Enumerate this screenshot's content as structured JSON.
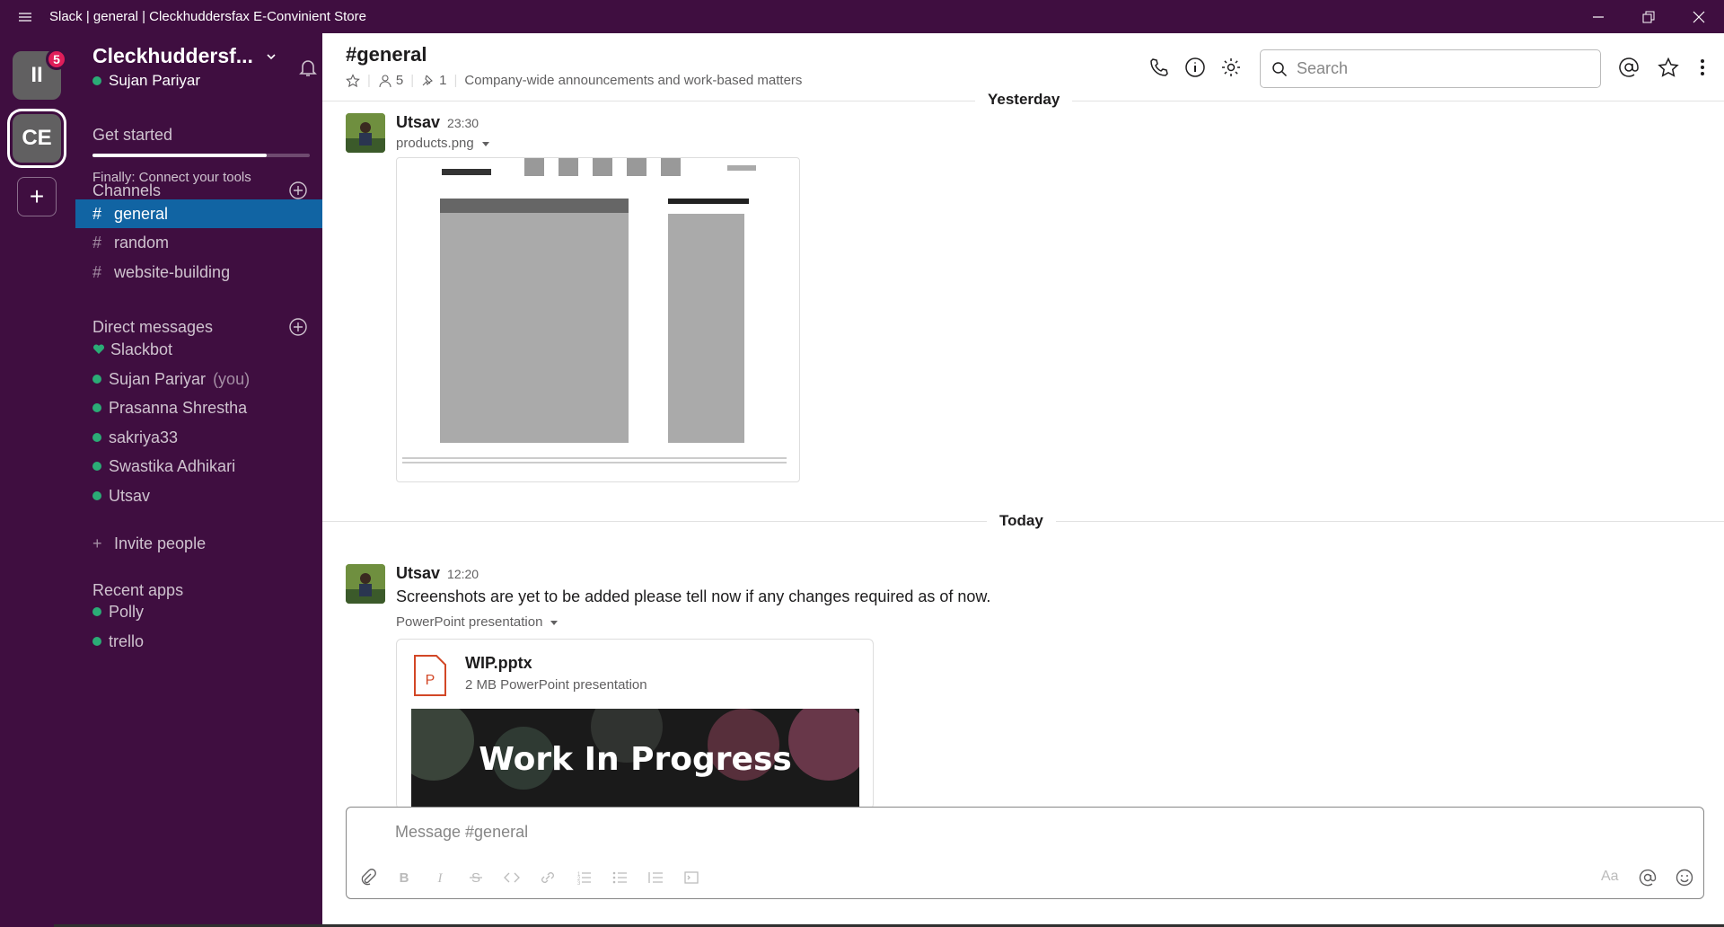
{
  "window": {
    "title": "Slack | general | Cleckhuddersfax E-Convinient Store"
  },
  "workspaces": [
    {
      "label": "II",
      "badge": "5"
    },
    {
      "label": "CE"
    },
    {
      "label": "+"
    }
  ],
  "sidebar": {
    "team_name": "Cleckhuddersf...",
    "user_name": "Sujan Pariyar",
    "get_started": {
      "label": "Get started",
      "progress": 0.8,
      "subtitle": "Finally: Connect your tools"
    },
    "channels_heading": "Channels",
    "channels": [
      {
        "name": "general",
        "active": true
      },
      {
        "name": "random",
        "active": false
      },
      {
        "name": "website-building",
        "active": false
      }
    ],
    "dm_heading": "Direct messages",
    "dms": [
      {
        "name": "Slackbot",
        "status": "heart"
      },
      {
        "name": "Sujan Pariyar",
        "you": "(you)"
      },
      {
        "name": "Prasanna Shrestha"
      },
      {
        "name": "sakriya33"
      },
      {
        "name": "Swastika Adhikari"
      },
      {
        "name": "Utsav"
      }
    ],
    "invite": "Invite people",
    "apps_heading": "Recent apps",
    "apps": [
      {
        "name": "Polly"
      },
      {
        "name": "trello"
      }
    ]
  },
  "channel": {
    "title": "#general",
    "members": "5",
    "pins": "1",
    "topic": "Company-wide announcements and work-based matters"
  },
  "search": {
    "placeholder": "Search"
  },
  "dividers": {
    "yesterday": "Yesterday",
    "today": "Today"
  },
  "messages": [
    {
      "author": "Utsav",
      "time": "23:30",
      "file_label": "products.png"
    },
    {
      "author": "Utsav",
      "time": "12:20",
      "text": "Screenshots are yet to be added please tell now if any changes required as of now.",
      "file_label": "PowerPoint presentation",
      "file": {
        "name": "WIP.pptx",
        "desc": "2 MB PowerPoint presentation",
        "preview_text": "Work In Progress"
      }
    }
  ],
  "composer": {
    "placeholder": "Message #general",
    "format_label": "Aa"
  },
  "colors": {
    "sidebar": "#3f0e40",
    "active": "#1164a3",
    "online": "#2bac76",
    "badge": "#e01e5a"
  }
}
